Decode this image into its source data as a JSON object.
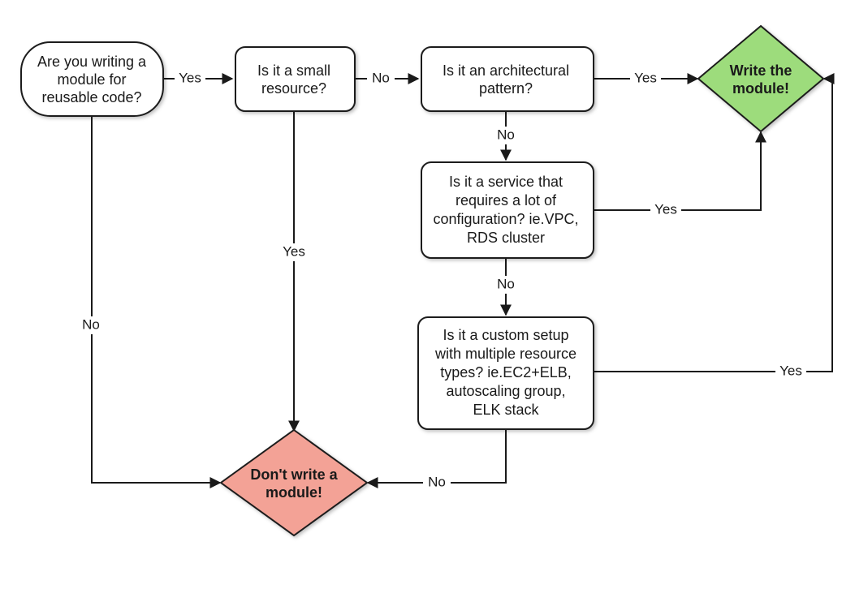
{
  "chart_data": {
    "type": "flowchart",
    "nodes": [
      {
        "id": "start",
        "shape": "terminator",
        "text": "Are you writing a module for reusable code?"
      },
      {
        "id": "small",
        "shape": "process",
        "text": "Is it a small resource?"
      },
      {
        "id": "arch",
        "shape": "process",
        "text": "Is it an architectural pattern?"
      },
      {
        "id": "config",
        "shape": "process",
        "text": "Is it a service that requires a lot of configuration? ie.VPC, RDS cluster"
      },
      {
        "id": "custom",
        "shape": "process",
        "text": "Is it a custom setup with multiple resource types? ie.EC2+ELB, autoscaling group, ELK stack"
      },
      {
        "id": "dont",
        "shape": "decision",
        "text": "Don't write a module!",
        "fill": "#f3a296"
      },
      {
        "id": "write",
        "shape": "decision",
        "text": "Write the module!",
        "fill": "#9ddc7c"
      }
    ],
    "edges": [
      {
        "from": "start",
        "to": "small",
        "label": "Yes"
      },
      {
        "from": "start",
        "to": "dont",
        "label": "No"
      },
      {
        "from": "small",
        "to": "arch",
        "label": "No"
      },
      {
        "from": "small",
        "to": "dont",
        "label": "Yes"
      },
      {
        "from": "arch",
        "to": "write",
        "label": "Yes"
      },
      {
        "from": "arch",
        "to": "config",
        "label": "No"
      },
      {
        "from": "config",
        "to": "write",
        "label": "Yes"
      },
      {
        "from": "config",
        "to": "custom",
        "label": "No"
      },
      {
        "from": "custom",
        "to": "write",
        "label": "Yes"
      },
      {
        "from": "custom",
        "to": "dont",
        "label": "No"
      }
    ]
  },
  "nodes": {
    "start": {
      "l1": "Are you writing a",
      "l2": "module for",
      "l3": "reusable code?"
    },
    "small": {
      "l1": "Is it a small",
      "l2": "resource?"
    },
    "arch": {
      "l1": "Is it an architectural",
      "l2": "pattern?"
    },
    "config": {
      "l1": "Is it a service that",
      "l2": "requires a lot of",
      "l3": "configuration? ie.VPC,",
      "l4": "RDS cluster"
    },
    "custom": {
      "l1": "Is it a custom setup",
      "l2": "with multiple resource",
      "l3": "types? ie.EC2+ELB,",
      "l4": "autoscaling group,",
      "l5": "ELK stack"
    },
    "dont": {
      "l1": "Don't write a",
      "l2": "module!"
    },
    "write": {
      "l1": "Write the",
      "l2": "module!"
    }
  },
  "labels": {
    "yes": "Yes",
    "no": "No"
  }
}
